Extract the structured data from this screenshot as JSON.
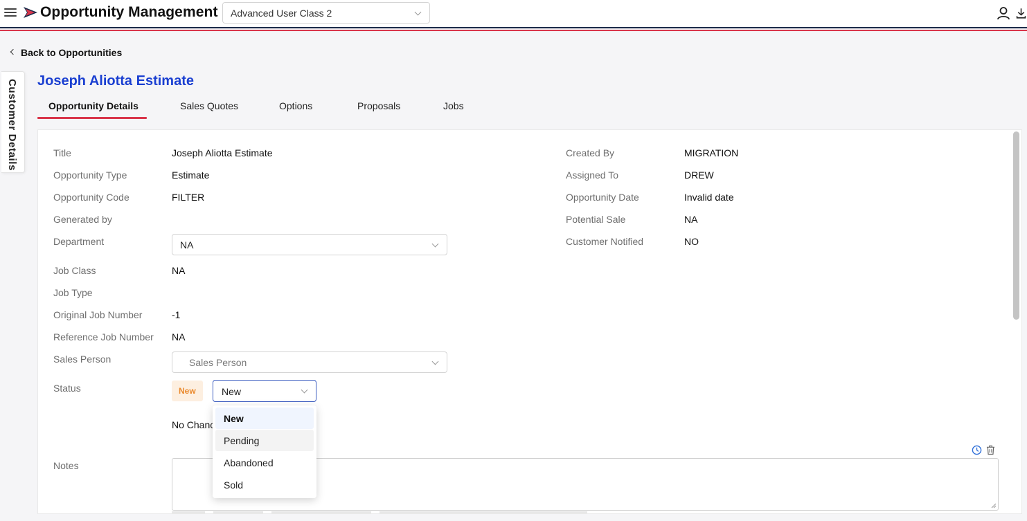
{
  "header": {
    "app_title": "Opportunity Management",
    "user_class": "Advanced User Class 2"
  },
  "nav": {
    "back_label": "Back to Opportunities",
    "side_tab": "Customer Details"
  },
  "page": {
    "title": "Joseph Aliotta Estimate",
    "tabs": [
      {
        "label": "Opportunity Details",
        "active": true
      },
      {
        "label": "Sales Quotes",
        "active": false
      },
      {
        "label": "Options",
        "active": false
      },
      {
        "label": "Proposals",
        "active": false
      },
      {
        "label": "Jobs",
        "active": false
      }
    ]
  },
  "details": {
    "left": {
      "title": {
        "label": "Title",
        "value": "Joseph Aliotta Estimate"
      },
      "opportunity_type": {
        "label": "Opportunity Type",
        "value": "Estimate"
      },
      "opportunity_code": {
        "label": "Opportunity Code",
        "value": "FILTER"
      },
      "generated_by": {
        "label": "Generated by",
        "value": ""
      },
      "department": {
        "label": "Department",
        "value": "NA"
      },
      "job_class": {
        "label": "Job Class",
        "value": "NA"
      },
      "job_type": {
        "label": "Job Type",
        "value": ""
      },
      "original_job_number": {
        "label": "Original Job Number",
        "value": "-1"
      },
      "reference_job_number": {
        "label": "Reference Job Number",
        "value": "NA"
      },
      "sales_person": {
        "label": "Sales Person",
        "placeholder": "Sales Person"
      },
      "status": {
        "label": "Status",
        "badge": "New",
        "value": "New"
      },
      "chance_text": "No Chance",
      "notes": {
        "label": "Notes",
        "value": ""
      }
    },
    "right": {
      "created_by": {
        "label": "Created By",
        "value": "MIGRATION"
      },
      "assigned_to": {
        "label": "Assigned To",
        "value": "DREW"
      },
      "opportunity_date": {
        "label": "Opportunity Date",
        "value": "Invalid date"
      },
      "potential_sale": {
        "label": "Potential Sale",
        "value": "NA"
      },
      "customer_notified": {
        "label": "Customer Notified",
        "value": "NO"
      }
    }
  },
  "status_dropdown": {
    "options": [
      "New",
      "Pending",
      "Abandoned",
      "Sold"
    ],
    "selected": "New",
    "hovered": "Pending"
  },
  "colors": {
    "title_blue": "#1a3fd1",
    "accent_red": "#d9364b",
    "badge_orange": "#ea8a2e",
    "focus_blue": "#3a5cc0"
  }
}
